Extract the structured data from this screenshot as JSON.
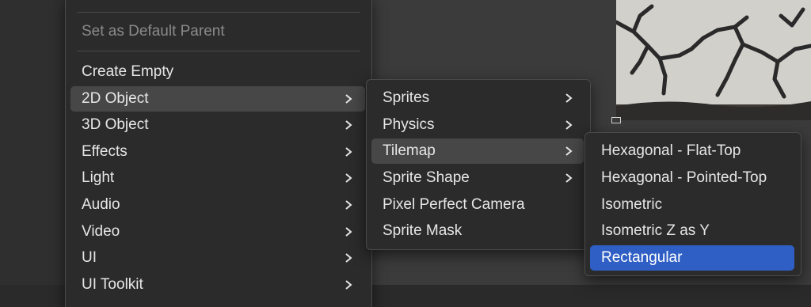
{
  "menu_main": {
    "items": [
      {
        "label": "Set as Default Parent",
        "state": "disabled"
      },
      {
        "label": "Create Empty"
      },
      {
        "label": "2D Object",
        "submenu": true,
        "state": "hover"
      },
      {
        "label": "3D Object",
        "submenu": true
      },
      {
        "label": "Effects",
        "submenu": true
      },
      {
        "label": "Light",
        "submenu": true
      },
      {
        "label": "Audio",
        "submenu": true
      },
      {
        "label": "Video",
        "submenu": true
      },
      {
        "label": "UI",
        "submenu": true
      },
      {
        "label": "UI Toolkit",
        "submenu": true
      }
    ]
  },
  "menu_2d": {
    "items": [
      {
        "label": "Sprites",
        "submenu": true
      },
      {
        "label": "Physics",
        "submenu": true
      },
      {
        "label": "Tilemap",
        "submenu": true,
        "state": "hover"
      },
      {
        "label": "Sprite Shape",
        "submenu": true
      },
      {
        "label": "Pixel Perfect Camera"
      },
      {
        "label": "Sprite Mask"
      }
    ]
  },
  "menu_tilemap": {
    "items": [
      {
        "label": "Hexagonal - Flat-Top"
      },
      {
        "label": "Hexagonal - Pointed-Top"
      },
      {
        "label": "Isometric"
      },
      {
        "label": "Isometric Z as Y"
      },
      {
        "label": "Rectangular",
        "state": "selected"
      }
    ]
  },
  "colors": {
    "menu_bg": "#2b2b2b",
    "hover": "#474747",
    "selected": "#2f5fc4",
    "text": "#e6e6e6",
    "disabled_text": "#8a8a8a"
  },
  "icons": [
    "chevron-right-icon",
    "scene-handle-icon"
  ]
}
